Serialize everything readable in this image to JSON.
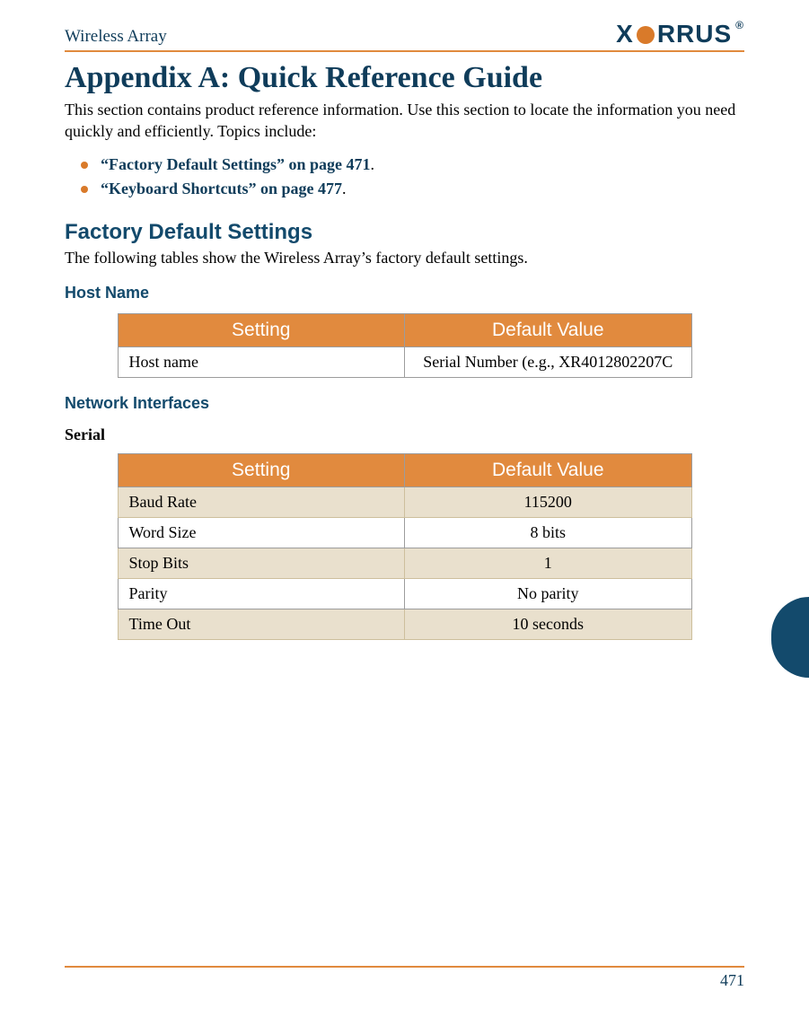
{
  "header": {
    "doc_title": "Wireless Array",
    "logo_text": {
      "pre": "X",
      "post": "RRUS"
    }
  },
  "title": "Appendix A: Quick Reference Guide",
  "intro": "This section contains product reference information. Use this section to locate the information you need quickly and efficiently. Topics include:",
  "topics": [
    {
      "link": "“Factory Default Settings” on page 471",
      "suffix": "."
    },
    {
      "link": "“Keyboard Shortcuts” on page 477",
      "suffix": "."
    }
  ],
  "section1": {
    "heading": "Factory Default Settings",
    "intro": "The following tables show the Wireless Array’s factory default settings."
  },
  "hostname_section": {
    "heading": "Host Name",
    "columns": {
      "setting": "Setting",
      "value": "Default Value"
    },
    "rows": [
      {
        "setting": "Host name",
        "value": "Serial Number (e.g., XR4012802207C"
      }
    ]
  },
  "network_section": {
    "heading": "Network Interfaces",
    "serial_heading": "Serial",
    "columns": {
      "setting": "Setting",
      "value": "Default Value"
    },
    "rows": [
      {
        "setting": "Baud Rate",
        "value": "115200"
      },
      {
        "setting": "Word Size",
        "value": "8 bits"
      },
      {
        "setting": "Stop Bits",
        "value": "1"
      },
      {
        "setting": "Parity",
        "value": "No parity"
      },
      {
        "setting": "Time Out",
        "value": "10 seconds"
      }
    ]
  },
  "footer": {
    "page_number": "471"
  }
}
